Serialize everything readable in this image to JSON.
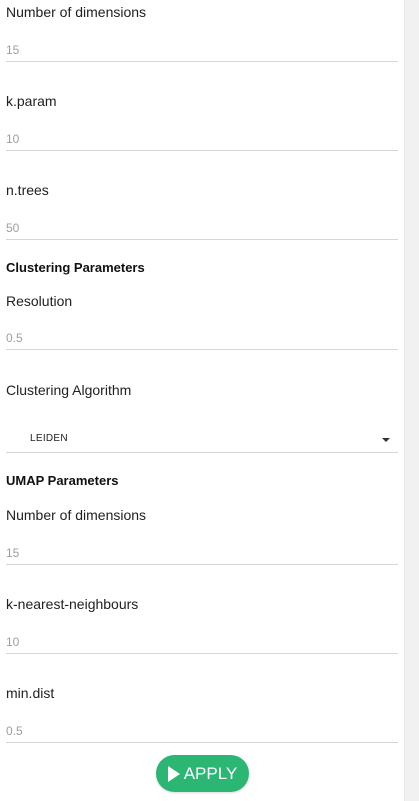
{
  "neighbours_params": {
    "dims": {
      "label": "Number of dimensions",
      "value": "15"
    },
    "k_param": {
      "label": "k.param",
      "value": "10"
    },
    "n_trees": {
      "label": "n.trees",
      "value": "50"
    }
  },
  "clustering": {
    "title": "Clustering Parameters",
    "resolution": {
      "label": "Resolution",
      "value": "0.5"
    },
    "algorithm": {
      "label": "Clustering Algorithm",
      "value": "LEIDEN"
    }
  },
  "umap": {
    "title": "UMAP Parameters",
    "dims": {
      "label": "Number of dimensions",
      "value": "15"
    },
    "knn": {
      "label": "k-nearest-neighbours",
      "value": "10"
    },
    "min_dist": {
      "label": "min.dist",
      "value": "0.5"
    }
  },
  "apply_button": {
    "label": "APPLY",
    "icon": "play-icon",
    "color": "#2bb673"
  }
}
